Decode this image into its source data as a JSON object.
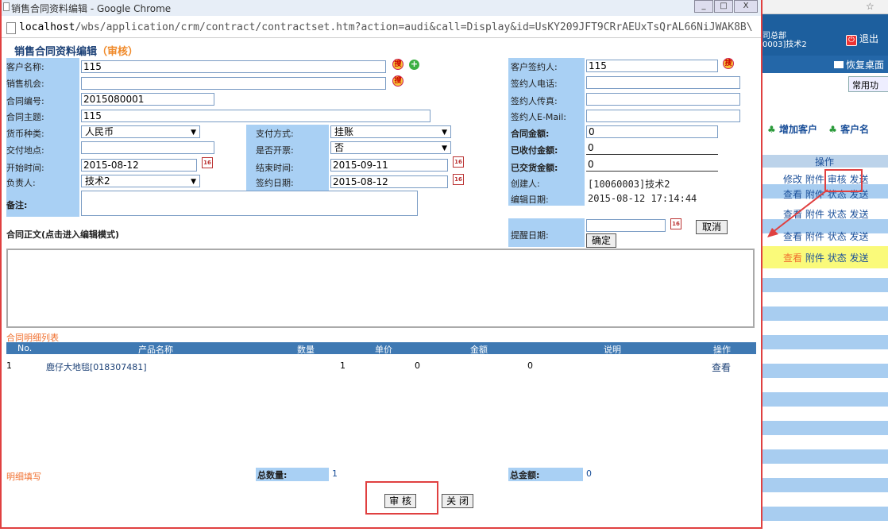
{
  "window": {
    "title": "销售合同资料编辑 - Google Chrome",
    "url_host": "localhost",
    "url_path": "/wbs/application/crm/contract/contractset.htm?action=audi&call=Display&id=UsKY209JFT9CRrAEUxTsQrAL66NiJWAK8B\\",
    "min": "_",
    "max": "□",
    "close": "X"
  },
  "form": {
    "title": "销售合同资料编辑",
    "title_sub": "（审核）",
    "labels": {
      "customer": "客户名称:",
      "opportunity": "销售机会:",
      "contract_no": "合同编号:",
      "subject": "合同主题:",
      "currency": "货币种类:",
      "pay_place": "交付地点:",
      "start_time": "开始时间:",
      "owner": "负责人:",
      "remark": "备注:",
      "pay_method": "支付方式:",
      "invoice": "是否开票:",
      "end_time": "结束时间:",
      "sign_date": "签约日期:",
      "signer": "客户签约人:",
      "signer_phone": "签约人电话:",
      "signer_fax": "签约人传真:",
      "signer_email": "签约人E-Mail:",
      "amount": "合同金额:",
      "received": "已收付金额:",
      "delivered": "已交货金额:",
      "creator": "创建人:",
      "edit_date": "编辑日期:",
      "remind_date": "提醒日期:",
      "body": "合同正文(点击进入编辑模式)"
    },
    "values": {
      "customer": "115",
      "opportunity": "",
      "contract_no": "2015080001",
      "subject": "115",
      "currency": "人民币",
      "pay_place": "",
      "start_time": "2015-08-12",
      "owner": "技术2",
      "remark": "",
      "pay_method": "挂账",
      "invoice": "否",
      "end_time": "2015-09-11",
      "sign_date": "2015-08-12",
      "signer": "115",
      "signer_phone": "",
      "signer_fax": "",
      "signer_email": "",
      "amount": "0",
      "received": "0",
      "delivered": "0",
      "creator": "[10060003]技术2",
      "edit_date": "2015-08-12 17:14:44",
      "remind_date": ""
    },
    "buttons": {
      "cancel": "取消",
      "confirm": "确定",
      "search_glyph": "搜",
      "cal_glyph": "16",
      "plus_glyph": "+"
    }
  },
  "detail": {
    "section_title": "合同明细列表",
    "columns": [
      "No.",
      "产品名称",
      "数量",
      "单价",
      "金额",
      "说明",
      "操作"
    ],
    "rows": [
      {
        "no": "1",
        "product": "鹿仔大地毯[018307481]",
        "qty": "1",
        "price": "0",
        "amount": "0",
        "note": "",
        "op": "查看"
      }
    ],
    "fill_label": "明细填写",
    "total_qty_label": "总数量:",
    "total_qty": "1",
    "total_amount_label": "总金额:",
    "total_amount": "0"
  },
  "actions": {
    "approve": "审 核",
    "close": "关 闭"
  },
  "background": {
    "org_line1": "司总部",
    "org_line2": "0003]技术2",
    "logout": "退出",
    "logout_glyph": "⏻",
    "restore": "恢复桌面",
    "common": "常用功",
    "add_customer": "增加客户",
    "customer_name": "客户名",
    "op_header": "操作",
    "rows": [
      [
        "修改",
        "附件",
        "审核",
        "发送"
      ],
      [
        "查看",
        "附件",
        "状态",
        "发送"
      ],
      [
        "查看",
        "附件",
        "状态",
        "发送"
      ],
      [
        "查看",
        "附件",
        "状态",
        "发送"
      ],
      [
        "查看",
        "附件",
        "状态",
        "发送"
      ]
    ]
  }
}
